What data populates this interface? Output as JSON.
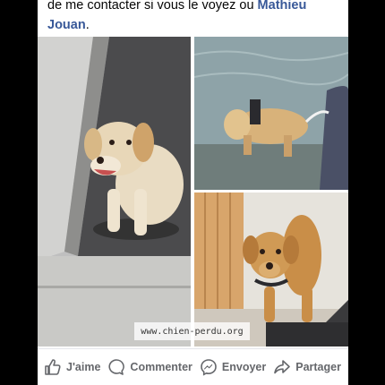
{
  "post": {
    "text_before": "de me contacter si vous le voyez ou ",
    "mention_first": "Mathieu",
    "mention_second": "Jouan",
    "text_after": "."
  },
  "watermark": "www.chien-perdu.org",
  "actions": {
    "like": {
      "label": "J'aime",
      "icon": "thumbs-up-icon"
    },
    "comment": {
      "label": "Commenter",
      "icon": "comment-bubble-icon"
    },
    "send": {
      "label": "Envoyer",
      "icon": "messenger-icon"
    },
    "share": {
      "label": "Partager",
      "icon": "share-arrow-icon"
    }
  },
  "colors": {
    "mention": "#385898",
    "action_text": "#65676b",
    "background": "#000000"
  }
}
